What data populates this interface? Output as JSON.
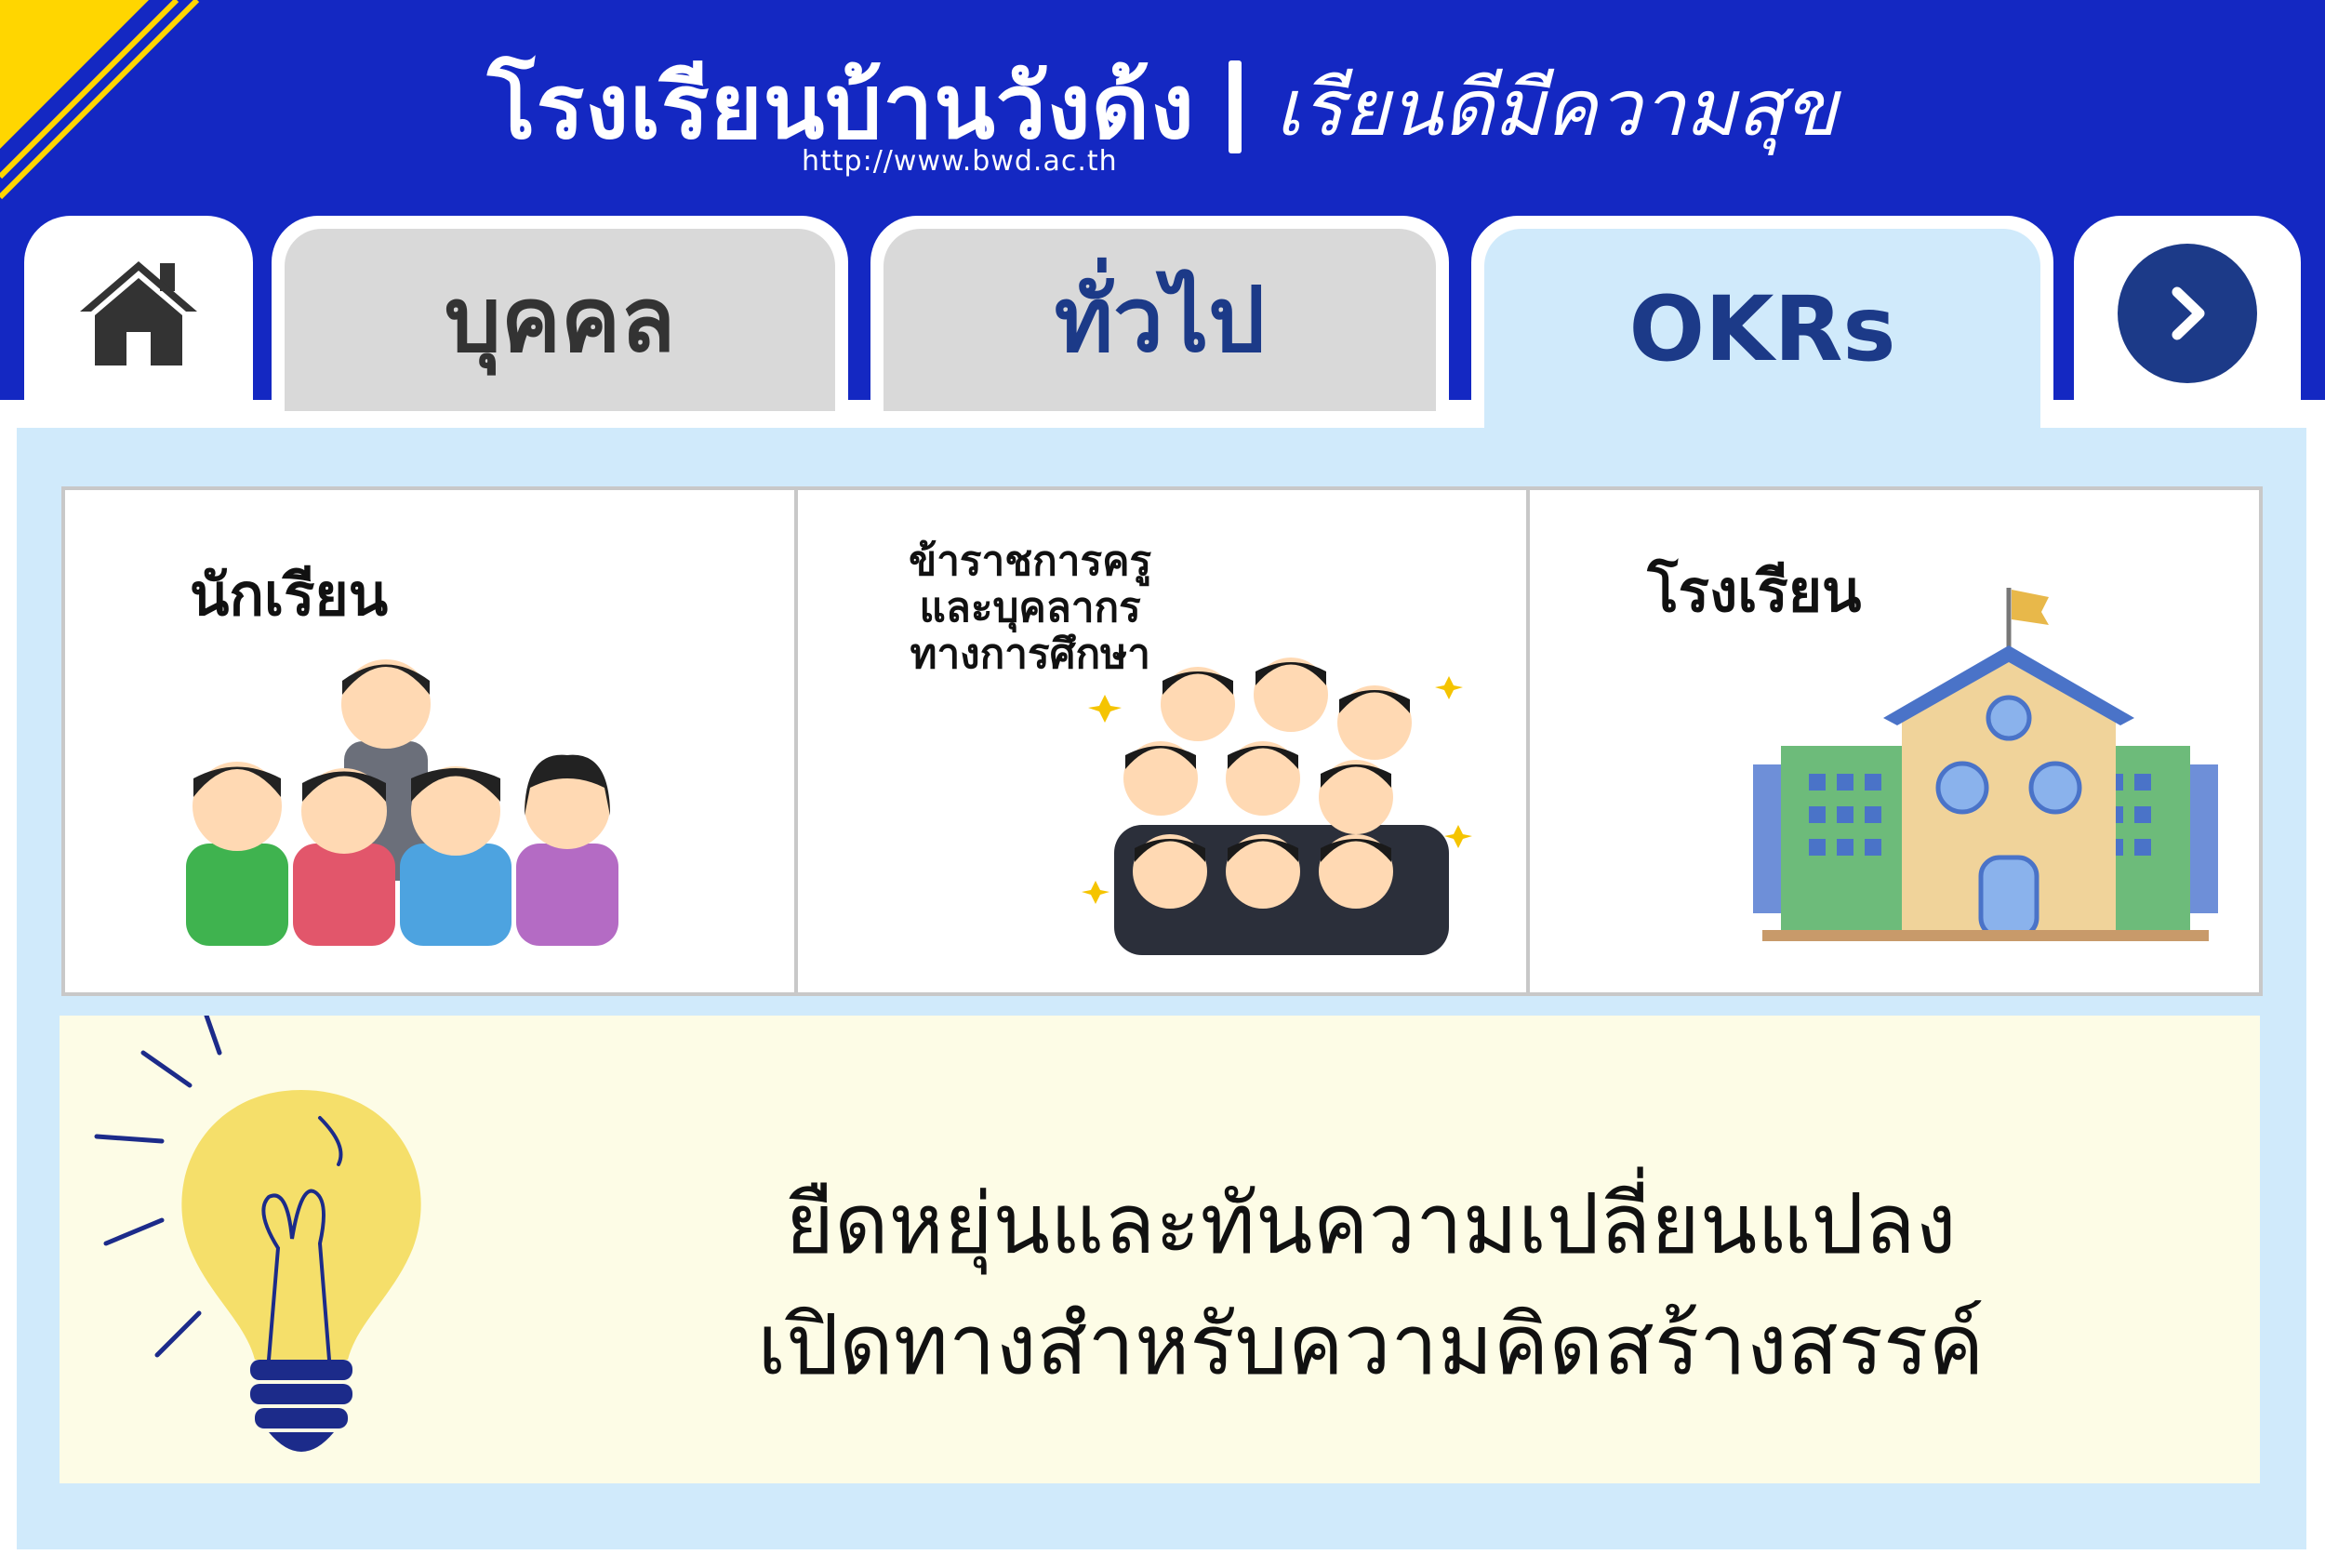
{
  "header": {
    "school_name": "โรงเรียนบ้านวังด้ง",
    "slogan": "เรียนดีมีความสุข",
    "url": "http://www.bwd.ac.th"
  },
  "tabs": {
    "home_icon": "home-icon",
    "personnel": "บุคคล",
    "general": "ทั่วไป",
    "okrs": "OKRs",
    "next_icon": "chevron-right-icon"
  },
  "cards": {
    "students": {
      "label": "นักเรียน",
      "icon": "students-illustration"
    },
    "teachers": {
      "label_line1": "ข้าราชการครู",
      "label_line2": "และบุคลากร",
      "label_line3": "ทางการศึกษา",
      "icon": "teachers-illustration"
    },
    "school": {
      "label": "โรงเรียน",
      "icon": "school-building-illustration"
    }
  },
  "idea": {
    "icon": "lightbulb-icon",
    "line1": "ยืดหยุ่นและทันความเปลี่ยนแปลง",
    "line2": "เปิดทางสำหรับความคิดสร้างสรรค์"
  },
  "colors": {
    "header_bg": "#1428c2",
    "accent_yellow": "#ffd600",
    "panel_bg": "#d0eafb",
    "idea_bg": "#fdfce6",
    "tab_inactive": "#d9d9d9",
    "tab_text": "#1c3a88"
  }
}
